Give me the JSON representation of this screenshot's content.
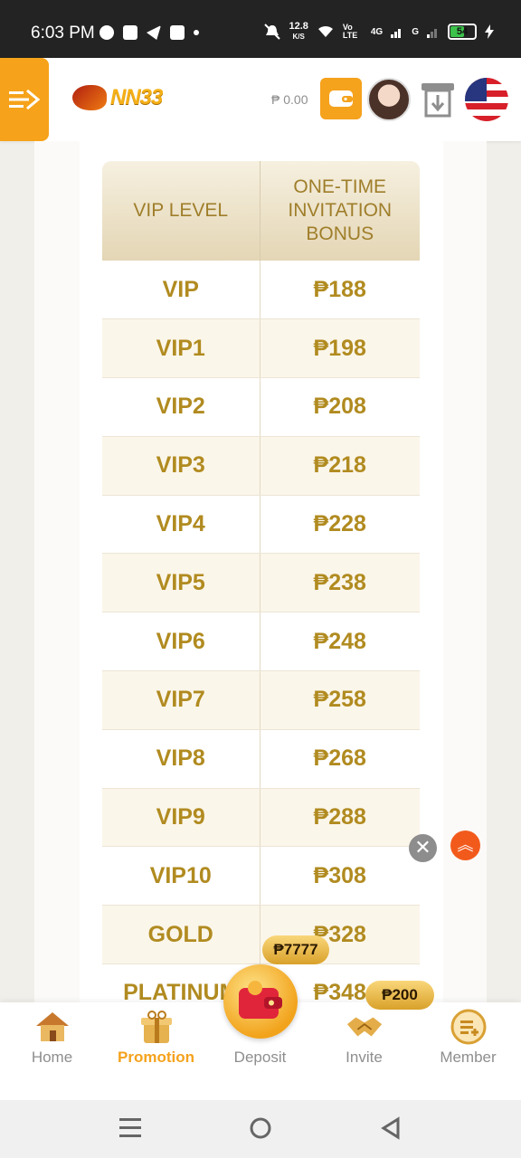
{
  "status_bar": {
    "time": "6:03 PM",
    "speed_value": "12.8",
    "speed_unit": "K/S",
    "network_volte": "Vo LTE",
    "network_4g": "4G",
    "network_g": "G",
    "battery": "54"
  },
  "header": {
    "logo_text": "NN33",
    "balance": "₱ 0.00"
  },
  "table": {
    "col1_header": "VIP LEVEL",
    "col2_header": "ONE-TIME INVITATION BONUS",
    "rows": [
      {
        "level": "VIP",
        "bonus": "₱188"
      },
      {
        "level": "VIP1",
        "bonus": "₱198"
      },
      {
        "level": "VIP2",
        "bonus": "₱208"
      },
      {
        "level": "VIP3",
        "bonus": "₱218"
      },
      {
        "level": "VIP4",
        "bonus": "₱228"
      },
      {
        "level": "VIP5",
        "bonus": "₱238"
      },
      {
        "level": "VIP6",
        "bonus": "₱248"
      },
      {
        "level": "VIP7",
        "bonus": "₱258"
      },
      {
        "level": "VIP8",
        "bonus": "₱268"
      },
      {
        "level": "VIP9",
        "bonus": "₱288"
      },
      {
        "level": "VIP10",
        "bonus": "₱308"
      },
      {
        "level": "GOLD",
        "bonus": "₱328"
      },
      {
        "level": "PLATINUM",
        "bonus": "₱348"
      }
    ]
  },
  "floating": {
    "badge_deposit": "₱7777",
    "badge_invite": "₱200",
    "close_symbol": "✕",
    "top_symbol": "︽"
  },
  "bottom_nav": {
    "items": [
      {
        "label": "Home",
        "icon": "home-icon"
      },
      {
        "label": "Promotion",
        "icon": "gift-icon"
      },
      {
        "label": "Deposit",
        "icon": "wallet-icon"
      },
      {
        "label": "Invite",
        "icon": "handshake-icon"
      },
      {
        "label": "Member",
        "icon": "member-icon"
      }
    ],
    "active": "Promotion"
  },
  "colors": {
    "accent": "#f5a21d",
    "gold_text": "#b18b20",
    "status_bar": "#232323"
  }
}
